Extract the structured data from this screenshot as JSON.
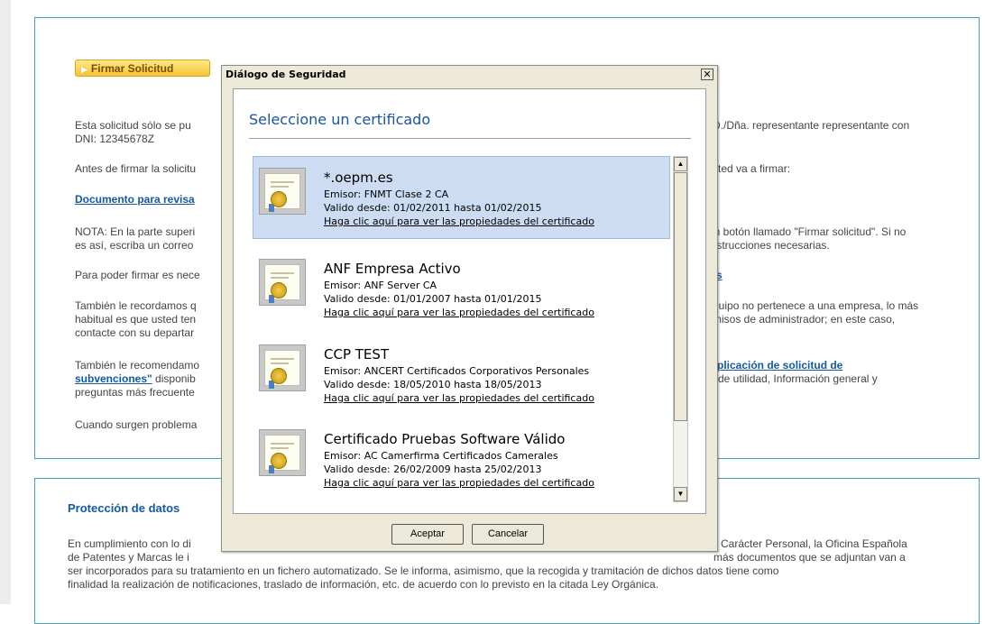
{
  "page": {
    "firmar_button": "Firmar Solicitud",
    "para1_left": "Esta solicitud sólo se pu",
    "para1_right": "D./Dña. representante representante con",
    "para1_line2": "DNI: 12345678Z",
    "para2_left": "Antes de firmar la solicitu",
    "para2_right": "sted va a firmar:",
    "doc_link": "Documento para revisa",
    "nota_left": "NOTA: En la parte superi",
    "nota_right": "un botón llamado \"Firmar solicitud\". Si no",
    "nota_left2": "es así, escriba un correo",
    "nota_right2": "instrucciones necesarias.",
    "para_poder_left": "Para poder firmar es nece",
    "para_poder_right_link": "s",
    "tambien1_l1": "También le recordamos q",
    "tambien1_r1": "quipo no pertenece a una empresa, lo más",
    "tambien1_l2": "habitual es que usted ten",
    "tambien1_r2": "misos de administrador; en este caso,",
    "tambien1_l3": "contacte con su departar",
    "tambien2_l1": "También le recomendamo",
    "tambien2_r1_link": "plicación de solicitud de",
    "tambien2_l2_link": "subvenciones\"",
    "tambien2_l2": " disponib",
    "tambien2_r2": "de utilidad, Información general y",
    "tambien2_l3": "preguntas más frecuente",
    "cuando": "Cuando surgen problema",
    "data_title": "Protección de datos",
    "data_l1_left": "En cumplimiento con lo di",
    "data_l1_right": "Carácter Personal, la Oficina Española",
    "data_l2_left": "de Patentes y Marcas le i",
    "data_l2_right": "más documentos que se adjuntan van a",
    "data_l3": "ser incorporados para su tratamiento en un fichero automatizado. Se le informa, asimismo, que la recogida y tramitación de dichos datos tiene como",
    "data_l4": "finalidad la realización de notificaciones, traslado de información, etc. de acuerdo con lo previsto en la citada Ley Orgánica."
  },
  "dialog": {
    "title": "Diálogo de Seguridad",
    "close_glyph": "✕",
    "heading": "Seleccione un certificado",
    "accept": "Aceptar",
    "cancel": "Cancelar",
    "certificates": [
      {
        "name": "*.oepm.es",
        "issuer": "Emisor: FNMT Clase 2 CA",
        "validity": "Valido desde: 01/02/2011 hasta 01/02/2015",
        "link": "Haga clic aquí para ver las propiedades del certificado",
        "selected": true
      },
      {
        "name": "ANF Empresa Activo",
        "issuer": "Emisor: ANF Server CA",
        "validity": "Valido desde: 01/01/2007 hasta 01/01/2015",
        "link": "Haga clic aquí para ver las propiedades del certificado",
        "selected": false
      },
      {
        "name": "CCP TEST",
        "issuer": "Emisor: ANCERT Certificados Corporativos Personales",
        "validity": "Valido desde: 18/05/2010 hasta 18/05/2013",
        "link": "Haga clic aquí para ver las propiedades del certificado",
        "selected": false
      },
      {
        "name": "Certificado Pruebas Software Válido",
        "issuer": "Emisor: AC Camerfirma Certificados Camerales",
        "validity": "Valido desde: 26/02/2009 hasta 25/02/2013",
        "link": "Haga clic aquí para ver las propiedades del certificado",
        "selected": false
      }
    ],
    "scroll_up": "▲",
    "scroll_down": "▼"
  }
}
